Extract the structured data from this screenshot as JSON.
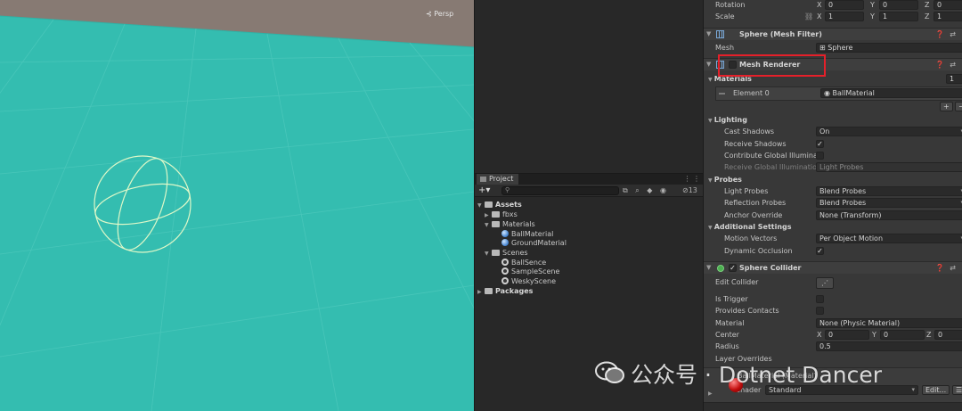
{
  "scene": {
    "projection_label": "⊰ Persp"
  },
  "project": {
    "tab_label": "Project",
    "tab_tools": "⋮ ⋮",
    "toolbar_plus": "+▾",
    "search_placeholder": "",
    "tool_icons": "⧉ ⌕ ◆ ◉",
    "hidden_count": "⊘13",
    "tree": {
      "assets": "Assets",
      "fbxs": "fbxs",
      "materials": "Materials",
      "ball_material": "BallMaterial",
      "ground_material": "GroundMaterial",
      "scenes": "Scenes",
      "ball_sence": "BallSence",
      "sample_scene": "SampleScene",
      "wesky_scene": "WeskyScene",
      "packages": "Packages"
    }
  },
  "inspector": {
    "transform": {
      "rotation_label": "Rotation",
      "scale_label": "Scale",
      "rotation": {
        "x": "0",
        "y": "0",
        "z": "0"
      },
      "scale": {
        "x": "1",
        "y": "1",
        "z": "1"
      },
      "axis_x": "X",
      "axis_y": "Y",
      "axis_z": "Z",
      "link_icon": "⛓"
    },
    "mesh_filter": {
      "title": "Sphere (Mesh Filter)",
      "mesh_label": "Mesh",
      "mesh_value": "⊞ Sphere",
      "header_tools": "❓⇄"
    },
    "mesh_renderer": {
      "title": "Mesh Renderer",
      "materials_label": "Materials",
      "materials_count": "1",
      "element0_label": "Element 0",
      "element0_value": "◉ BallMaterial",
      "add_btn": "+",
      "remove_btn": "−",
      "lighting_label": "Lighting",
      "cast_shadows_label": "Cast Shadows",
      "cast_shadows_value": "On",
      "receive_shadows_label": "Receive Shadows",
      "receive_shadows_check": "✓",
      "contribute_gi_label": "Contribute Global Illumination",
      "receive_gi_label": "Receive Global Illumination",
      "receive_gi_value": "Light Probes",
      "probes_label": "Probes",
      "light_probes_label": "Light Probes",
      "light_probes_value": "Blend Probes",
      "reflection_probes_label": "Reflection Probes",
      "reflection_probes_value": "Blend Probes",
      "anchor_override_label": "Anchor Override",
      "anchor_override_value": "None (Transform)",
      "additional_settings_label": "Additional Settings",
      "motion_vectors_label": "Motion Vectors",
      "motion_vectors_value": "Per Object Motion",
      "dynamic_occlusion_label": "Dynamic Occlusion",
      "dynamic_occlusion_check": "✓"
    },
    "sphere_collider": {
      "title": "Sphere Collider",
      "enabled_check": "✓",
      "edit_collider_label": "Edit Collider",
      "edit_collider_icon": "⋰",
      "is_trigger_label": "Is Trigger",
      "provides_contacts_label": "Provides Contacts",
      "material_label": "Material",
      "material_value": "None (Physic Material)",
      "center_label": "Center",
      "center": {
        "x": "0",
        "y": "0",
        "z": "0"
      },
      "radius_label": "Radius",
      "radius_value": "0.5",
      "layer_overrides_label": "Layer Overrides"
    },
    "material_footer": {
      "name": "BallMaterial (Material)",
      "shader_label": "Shader",
      "shader_value": "Standard",
      "edit_btn": "Edit...",
      "list_btn": "☰"
    }
  },
  "watermark": {
    "text": "公众号 · Dotnet Dancer"
  },
  "colors": {
    "scene_floor": "#34bdb0",
    "scene_sky": "#877a73",
    "highlight_box": "#e5202a",
    "inspector_bg": "#383838",
    "panel_bg": "#282828"
  }
}
